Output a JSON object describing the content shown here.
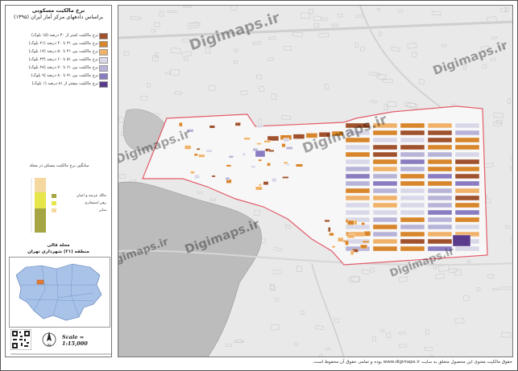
{
  "title_line1": "نرخ مالکیت مسکونی",
  "title_line2": "براساس دادههای مرکز آمار ایران (۱۳۹۵)",
  "legend": [
    {
      "label": "نرخ مالکیت کمتر از ۳۰ درصد (۱۵ بلوک)",
      "color": "#a0522d"
    },
    {
      "label": "نرخ مالکیت بین ۳۱ تا ۴۰ درصد (۲۱ بلوک)",
      "color": "#d8862c"
    },
    {
      "label": "نرخ مالکیت بین ۴۱ تا ۵۰ درصد (۱۷ بلوک)",
      "color": "#f0b26a"
    },
    {
      "label": "نرخ مالکیت بین ۵۱ تا ۶۰ درصد (۴۳ بلوک)",
      "color": "#d8d8e8"
    },
    {
      "label": "نرخ مالکیت بین ۶۱ تا ۷۰ درصد (۲۸ بلوک)",
      "color": "#b8b4d8"
    },
    {
      "label": "نرخ مالکیت بین ۷۱ تا ۸۰ درصد (۹ بلوک)",
      "color": "#8a7cc0"
    },
    {
      "label": "نرخ مالکیت بیشتر از ۸۱ درصد (۱ بلوک)",
      "color": "#5a3a8a"
    }
  ],
  "chart_title": "میانگین نرخ مالکیت مسکن در محله",
  "chart_legend": [
    {
      "label": "مالک عرصه و اعیان",
      "color": "#a5a544"
    },
    {
      "label": "رهن استیجاری",
      "color": "#e6e64a"
    },
    {
      "label": "سایر",
      "color": "#f5d8a0"
    }
  ],
  "area_line1": "محله قالی",
  "area_line2": "منطقه (۲۱) شهرداری تهران",
  "scale": "Scale = 1:15,000",
  "watermark": "Digimaps.ir",
  "credit": "حقوق مالکیت معنوی این محصول متعلق به سایت www.digimaps.ir بوده و تمامی حقوق آن محفوظ است.",
  "colors": {
    "boundary": "#e25c6a",
    "map_bg": "#e9e9e9",
    "district": "#a8c2e8",
    "highlight": "#e07a30"
  }
}
